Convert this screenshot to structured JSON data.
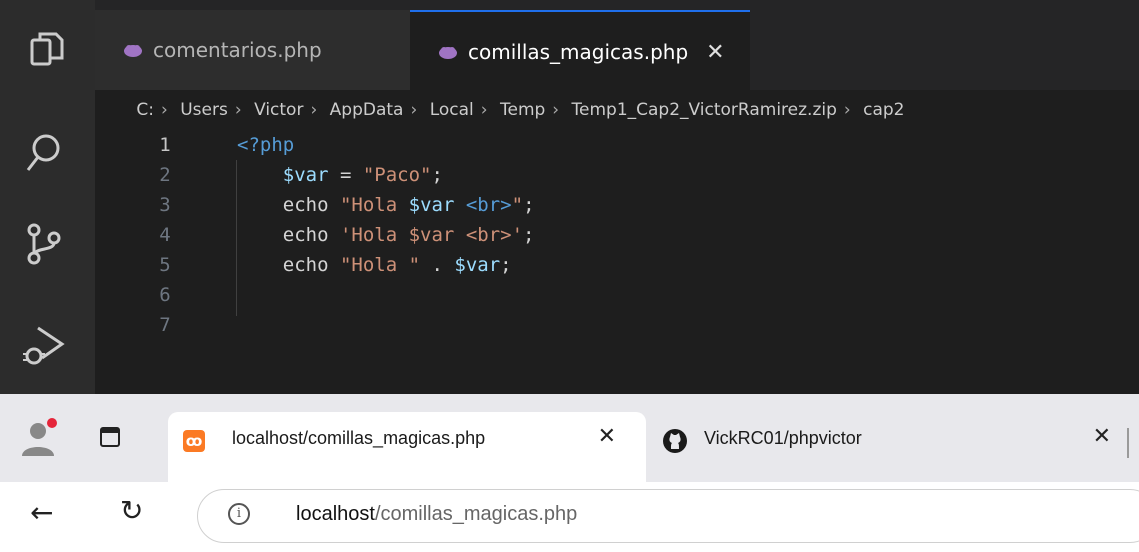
{
  "editor": {
    "tabs": [
      {
        "label": "comentarios.php",
        "active": false
      },
      {
        "label": "comillas_magicas.php",
        "active": true
      }
    ],
    "close_glyph": "✕",
    "breadcrumb": [
      "C:",
      "Users",
      "Victor",
      "AppData",
      "Local",
      "Temp",
      "Temp1_Cap2_VictorRamirez.zip",
      "cap2"
    ],
    "breadcrumb_separator": "›",
    "lines": [
      {
        "n": "1",
        "text": "<?php"
      },
      {
        "n": "2",
        "text": "    $var = \"Paco\";"
      },
      {
        "n": "3",
        "text": "    echo \"Hola $var <br>\";"
      },
      {
        "n": "4",
        "text": "    echo 'Hola $var <br>';"
      },
      {
        "n": "5",
        "text": "    echo \"Hola \" . $var;"
      },
      {
        "n": "6",
        "text": ""
      },
      {
        "n": "7",
        "text": ""
      }
    ],
    "activity_icons": [
      "explorer-icon",
      "search-icon",
      "source-control-icon",
      "run-debug-icon"
    ]
  },
  "browser": {
    "tabs": [
      {
        "title": "localhost/comillas_magicas.php",
        "icon": "xampp-icon",
        "active": true
      },
      {
        "title": "VickRC01/phpvictor",
        "icon": "github-icon",
        "active": false
      }
    ],
    "tab_close_glyph": "✕",
    "url_host": "localhost",
    "url_path": "/comillas_magicas.php",
    "back_glyph": "←",
    "refresh_glyph": "↻",
    "info_glyph": "i"
  },
  "colors": {
    "accent": "#1f6feb",
    "php_keyword": "#569cd6",
    "variable": "#9cdcfe",
    "string": "#ce9178"
  }
}
